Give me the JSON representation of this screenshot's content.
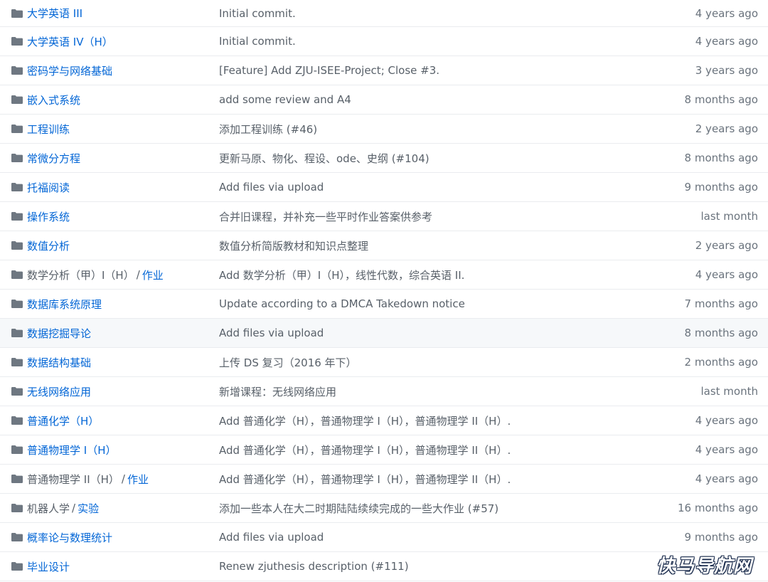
{
  "colors": {
    "link": "#0366d6",
    "muted": "#586069",
    "folder": "#79b8ff",
    "border": "#eaecef"
  },
  "rows": [
    {
      "name": "大学英语 III",
      "message": "Initial commit.",
      "age": "4 years ago"
    },
    {
      "name": "大学英语 IV（H）",
      "message": "Initial commit.",
      "age": "4 years ago"
    },
    {
      "name": "密码学与网络基础",
      "message": "[Feature] Add ZJU-ISEE-Project; Close #3.",
      "age": "3 years ago"
    },
    {
      "name": "嵌入式系统",
      "message": "add some review and A4",
      "age": "8 months ago"
    },
    {
      "name": "工程训练",
      "message": "添加工程训练 (#46)",
      "age": "2 years ago"
    },
    {
      "name": "常微分方程",
      "message": "更新马原、物化、程设、ode、史纲 (#104)",
      "age": "8 months ago"
    },
    {
      "name": "托福阅读",
      "message": "Add files via upload",
      "age": "9 months ago"
    },
    {
      "name": "操作系统",
      "message": "合并旧课程，并补充一些平时作业答案供参考",
      "age": "last month"
    },
    {
      "name": "数值分析",
      "message": "数值分析简版教材和知识点整理",
      "age": "2 years ago"
    },
    {
      "name": "数学分析（甲）I（H）",
      "sep": "/",
      "sub": "作业",
      "message": "Add 数学分析（甲）I（H），线性代数，综合英语 II.",
      "age": "4 years ago"
    },
    {
      "name": "数据库系统原理",
      "message": "Update according to a DMCA Takedown notice",
      "age": "7 months ago"
    },
    {
      "name": "数据挖掘导论",
      "message": "Add files via upload",
      "age": "8 months ago"
    },
    {
      "name": "数据结构基础",
      "message": "上传 DS 复习（2016 年下）",
      "age": "2 months ago"
    },
    {
      "name": "无线网络应用",
      "message": "新增课程：无线网络应用",
      "age": "last month"
    },
    {
      "name": "普通化学（H）",
      "message": "Add 普通化学（H），普通物理学 I（H），普通物理学 II（H）.",
      "age": "4 years ago"
    },
    {
      "name": "普通物理学 I（H）",
      "message": "Add 普通化学（H），普通物理学 I（H），普通物理学 II（H）.",
      "age": "4 years ago"
    },
    {
      "name": "普通物理学 II（H）",
      "sep": "/",
      "sub": "作业",
      "message": "Add 普通化学（H），普通物理学 I（H），普通物理学 II（H）.",
      "age": "4 years ago"
    },
    {
      "name": "机器人学",
      "sep": "/",
      "sub": "实验",
      "message": "添加一些本人在大二时期陆陆续续完成的一些大作业 (#57)",
      "age": "16 months ago"
    },
    {
      "name": "概率论与数理统计",
      "message": "Add files via upload",
      "age": "9 months ago"
    },
    {
      "name": "毕业设计",
      "message": "Renew zjuthesis description (#111)",
      "age": ""
    }
  ],
  "watermark": "快马导航网"
}
